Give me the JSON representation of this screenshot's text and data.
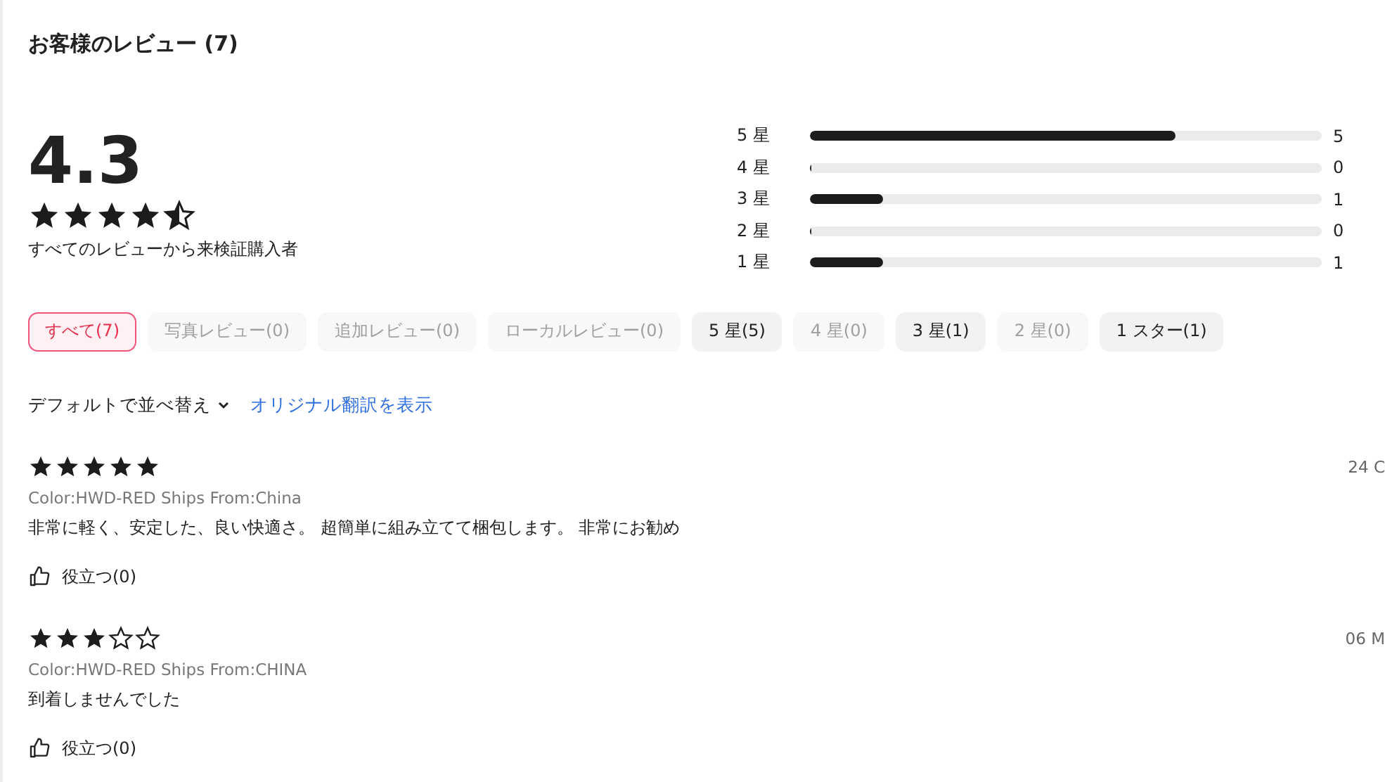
{
  "title": "お客様のレビュー (7)",
  "summary": {
    "score": "4.3",
    "stars": 4.5,
    "note": "すべてのレビューから来検証購入者"
  },
  "breakdown": [
    {
      "label": "5 星",
      "level": 0.714,
      "count": "5"
    },
    {
      "label": "4 星",
      "level": 0,
      "count": "0"
    },
    {
      "label": "3 星",
      "level": 0.143,
      "count": "1"
    },
    {
      "label": "2 星",
      "level": 0,
      "count": "0"
    },
    {
      "label": "1 星",
      "level": 0.143,
      "count": "1"
    }
  ],
  "filters": [
    {
      "label": "すべて(7)",
      "selected": true,
      "disabled": false
    },
    {
      "label": "写真レビュー(0)",
      "selected": false,
      "disabled": true
    },
    {
      "label": "追加レビュー(0)",
      "selected": false,
      "disabled": true
    },
    {
      "label": "ローカルレビュー(0)",
      "selected": false,
      "disabled": true
    },
    {
      "label": "5 星(5)",
      "selected": false,
      "disabled": false
    },
    {
      "label": "4 星(0)",
      "selected": false,
      "disabled": true
    },
    {
      "label": "3 星(1)",
      "selected": false,
      "disabled": false
    },
    {
      "label": "2 星(0)",
      "selected": false,
      "disabled": true
    },
    {
      "label": "1 スター(1)",
      "selected": false,
      "disabled": false
    }
  ],
  "sort": {
    "label": "デフォルトで並べ替え",
    "link": "オリジナル翻訳を表示"
  },
  "reviews": [
    {
      "stars": 5,
      "date": "24 C",
      "meta": "Color:HWD-RED Ships From:China",
      "text": "非常に軽く、安定した、良い快適さ。 超簡単に組み立てて梱包します。 非常にお勧め",
      "helpful": "役立つ(0)"
    },
    {
      "stars": 3,
      "date": "06 M",
      "meta": "Color:HWD-RED Ships From:CHINA",
      "text": "到着しませんでした",
      "helpful": "役立つ(0)"
    }
  ]
}
